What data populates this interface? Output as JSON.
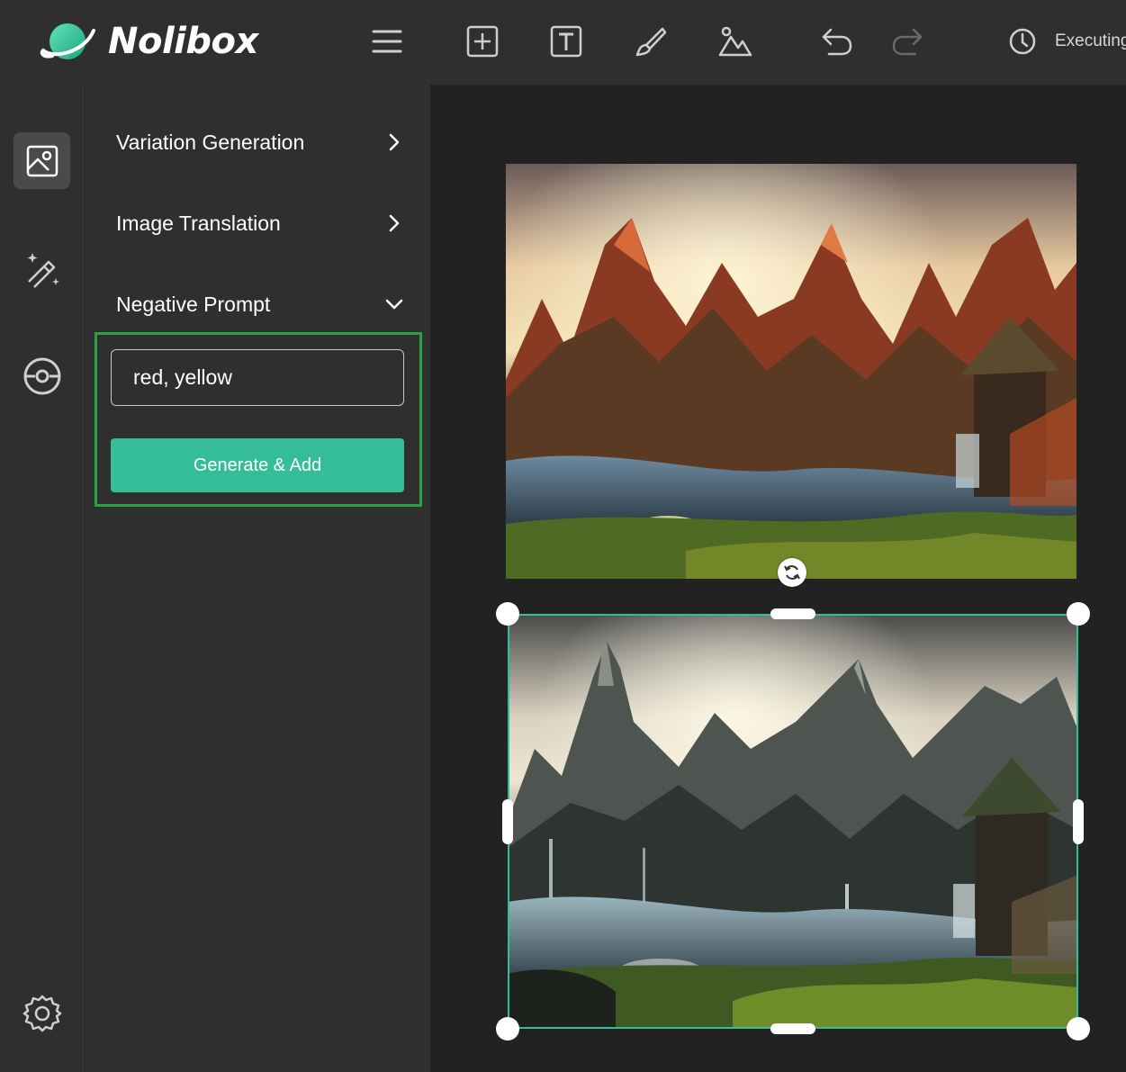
{
  "app": {
    "name": "Nolibox",
    "accent": "#35bd97",
    "highlight": "#2ea043"
  },
  "toolbar": {
    "icons": [
      "menu-icon",
      "add-frame-icon",
      "text-icon",
      "brush-icon",
      "image-icon",
      "undo-icon",
      "redo-icon"
    ],
    "status_text": "Executing"
  },
  "rail": {
    "items": [
      "image-panel-icon",
      "magic-wand-icon",
      "plugin-icon",
      "settings-icon"
    ]
  },
  "panel": {
    "items": [
      {
        "label": "Variation Generation",
        "expanded": false
      },
      {
        "label": "Image Translation",
        "expanded": false
      },
      {
        "label": "Negative Prompt",
        "expanded": true
      }
    ],
    "negative_prompt": {
      "value": "red, yellow",
      "placeholder": ""
    },
    "generate_label": "Generate & Add"
  }
}
